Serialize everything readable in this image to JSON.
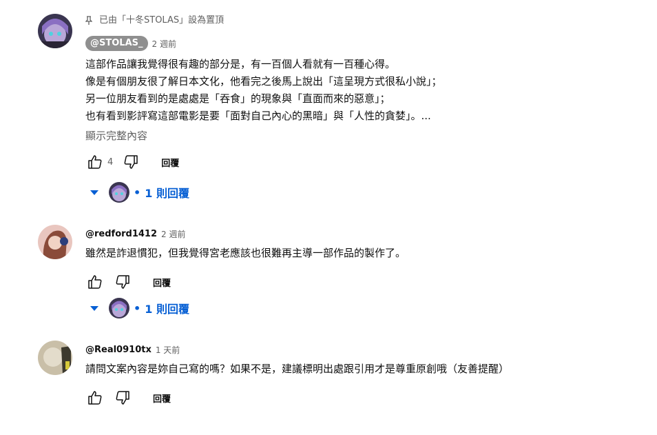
{
  "comments": [
    {
      "pinned_text": "已由「十冬STOLAS」設為置頂",
      "author": "@STOLAS_",
      "time": "2 週前",
      "lines": [
        "這部作品讓我覺得很有趣的部分是，有一百個人看就有一百種心得。",
        "像是有個朋友很了解日本文化，他看完之後馬上說出「這呈現方式很私小說」；",
        "另一位朋友看到的是處處是「吞食」的現象與「直面而來的惡意」；",
        "也有看到影評寫這部電影是要「面對自己內心的黑暗」與「人性的貪婪」。..."
      ],
      "show_more": "顯示完整內容",
      "likes": "4",
      "reply_label": "回覆",
      "replies_label": "1 則回覆"
    },
    {
      "author": "@redford1412",
      "time": "2 週前",
      "lines": [
        "雖然是詐退慣犯，但我覺得宮老應該也很難再主導一部作品的製作了。"
      ],
      "reply_label": "回覆",
      "replies_label": "1 則回覆"
    },
    {
      "author": "@Real0910tx",
      "time": "1 天前",
      "lines": [
        "請問文案內容是妳自己寫的嗎？如果不是，建議標明出處跟引用才是尊重原創哦（友善提醒）"
      ],
      "reply_label": "回覆"
    }
  ],
  "icons": {
    "pin": "pin-icon",
    "like": "thumb-up-icon",
    "dislike": "thumb-down-icon",
    "expand": "caret-down-icon"
  },
  "colors": {
    "link_blue": "#065fd4",
    "secondary_text": "#606060",
    "chip_bg": "#8f8f8f"
  }
}
